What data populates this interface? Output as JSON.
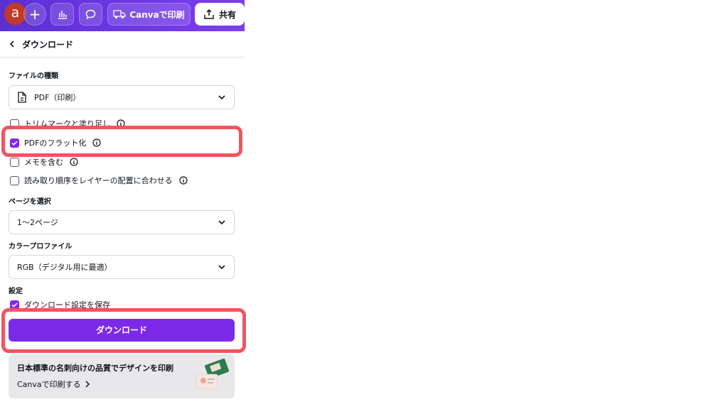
{
  "topbar": {
    "avatar_letter": "a",
    "plus": "+",
    "print_label": "Canvaで印刷",
    "share_label": "共有"
  },
  "panel": {
    "title": "ダウンロード",
    "file_type": {
      "label": "ファイルの種類",
      "value": "PDF（印刷）"
    },
    "options": [
      {
        "label": "トリムマークと塗り足し",
        "checked": false
      },
      {
        "label": "PDFのフラット化",
        "checked": true
      },
      {
        "label": "メモを含む",
        "checked": false
      },
      {
        "label": "読み取り順序をレイヤーの配置に合わせる",
        "checked": false
      }
    ],
    "pages": {
      "label": "ページを選択",
      "value": "1〜2ページ"
    },
    "color_profile": {
      "label": "カラープロファイル",
      "value": "RGB（デジタル用に最適）"
    },
    "settings": {
      "label": "設定",
      "save_label": "ダウンロード設定を保存",
      "save_checked": true
    },
    "download_button": "ダウンロード",
    "promo": {
      "title": "日本標準の名刺向けの品質でデザインを印刷",
      "link": "Canvaで印刷する"
    }
  },
  "colors": {
    "accent": "#7d2ae8",
    "highlight": "#f0555f",
    "topbar": "#6a35e0"
  }
}
